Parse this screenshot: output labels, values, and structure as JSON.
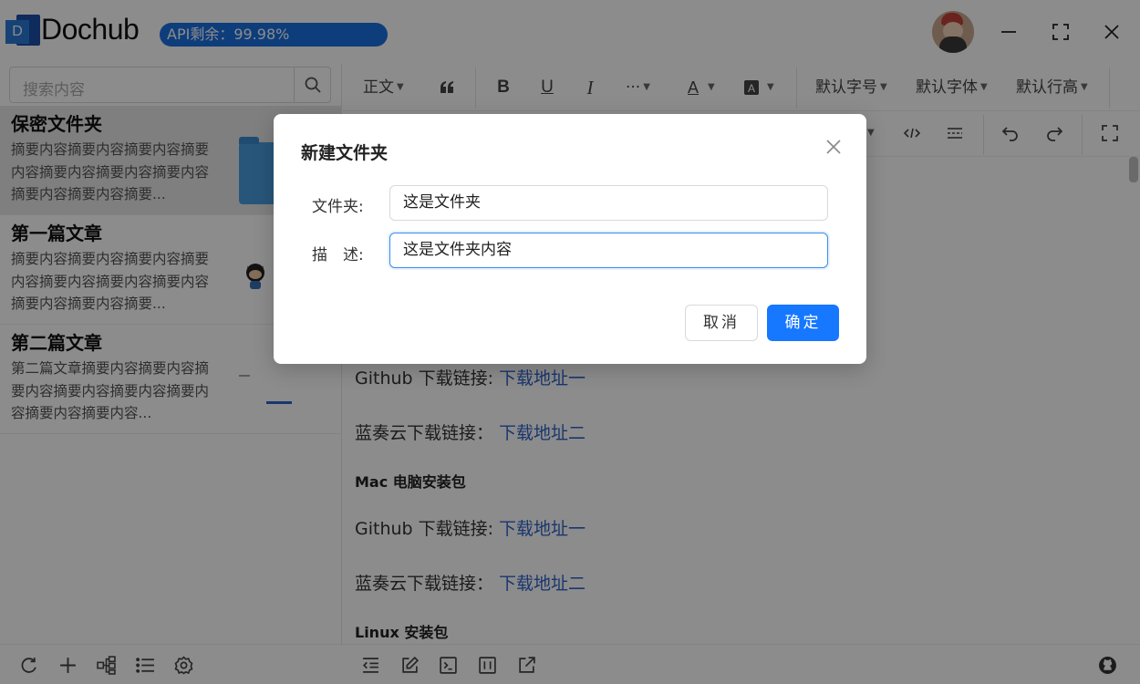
{
  "app": {
    "logo_letter": "D",
    "brand": "Dochub",
    "api_status": "API剩余：99.98%"
  },
  "window_controls": {
    "avatar": "user-avatar",
    "minimize_icon": "minimize-icon",
    "maximize_icon": "maximize-icon",
    "close_icon": "close-icon"
  },
  "sidebar": {
    "search_placeholder": "搜索内容",
    "items": [
      {
        "title": "保密文件夹",
        "summary": "摘要内容摘要内容摘要内容摘要内容摘要内容摘要内容摘要内容摘要内容摘要内容摘要...",
        "thumbnail": "folder-thumbnail"
      },
      {
        "title": "第一篇文章",
        "summary": "摘要内容摘要内容摘要内容摘要内容摘要内容摘要内容摘要内容摘要内容摘要内容摘要...",
        "thumbnail": "github-octocat-thumbnail"
      },
      {
        "title": "第二篇文章",
        "summary": "第二篇文章摘要内容摘要内容摘要内容摘要内容摘要内容摘要内容摘要内容摘要内容...",
        "thumbnail": "image-thumbnail"
      }
    ]
  },
  "editor": {
    "toolbar": {
      "paragraph": "正文",
      "font_size": "默认字号",
      "font_family": "默认字体",
      "line_height": "默认行高",
      "more": "···"
    },
    "content": [
      {
        "type": "link-line",
        "label": "Github 下载链接:",
        "link": "下载地址一"
      },
      {
        "type": "link-line",
        "label": "蓝奏云下载链接：",
        "link": "下载地址二"
      },
      {
        "type": "heading",
        "text": "Mac 电脑安装包"
      },
      {
        "type": "link-line",
        "label": "Github 下载链接:",
        "link": "下载地址一"
      },
      {
        "type": "link-line",
        "label": "蓝奏云下载链接：",
        "link": "下载地址二"
      },
      {
        "type": "heading",
        "text": "Linux 安装包"
      }
    ]
  },
  "modal": {
    "title": "新建文件夹",
    "folder_label": "文件夹:",
    "folder_value": "这是文件夹",
    "desc_label": "描　述:",
    "desc_value": "这是文件夹内容",
    "cancel": "取消",
    "confirm": "确定"
  },
  "colors": {
    "accent": "#1677ff",
    "api_bar": "#1a6fe0",
    "link": "#2f63c8",
    "overlay": "rgba(0,0,0,0.45)"
  }
}
